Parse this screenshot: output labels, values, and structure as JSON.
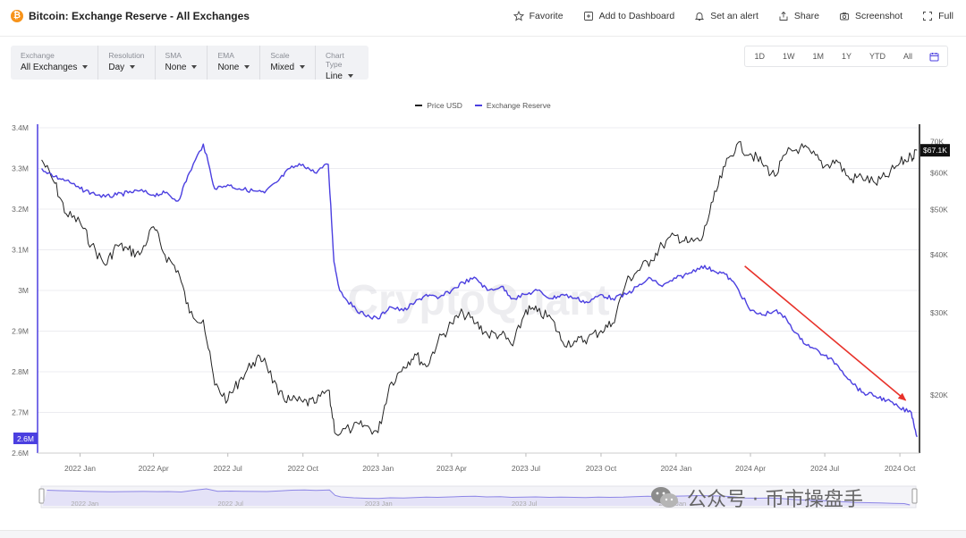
{
  "header": {
    "logo_symbol": "₿",
    "title": "Bitcoin: Exchange Reserve - All Exchanges",
    "actions": [
      {
        "label": "Favorite",
        "icon": "star-icon"
      },
      {
        "label": "Add to Dashboard",
        "icon": "dashboard-add-icon"
      },
      {
        "label": "Set an alert",
        "icon": "bell-icon"
      },
      {
        "label": "Share",
        "icon": "share-icon"
      },
      {
        "label": "Screenshot",
        "icon": "camera-icon"
      },
      {
        "label": "Full",
        "icon": "fullscreen-icon"
      }
    ]
  },
  "filters": [
    {
      "label": "Exchange",
      "value": "All Exchanges"
    },
    {
      "label": "Resolution",
      "value": "Day"
    },
    {
      "label": "SMA",
      "value": "None"
    },
    {
      "label": "EMA",
      "value": "None"
    },
    {
      "label": "Scale",
      "value": "Mixed"
    },
    {
      "label": "Chart Type",
      "value": "Line"
    }
  ],
  "ranges": [
    "1D",
    "1W",
    "1M",
    "1Y",
    "YTD",
    "All"
  ],
  "watermark": "CryptoQuant",
  "wechat_text": "公众号 · 币市操盘手",
  "colors": {
    "price": "#222222",
    "reserve": "#4b3fe0",
    "arrow": "#e8322a",
    "badge_reserve": "#4b3fe0",
    "badge_price": "#111111"
  },
  "chart_data": {
    "type": "line",
    "legend": [
      "Price USD",
      "Exchange Reserve"
    ],
    "legend_position": "top-center",
    "grid": {
      "horizontal": true,
      "vertical": false
    },
    "x_ticks": [
      "2022 Jan",
      "2022 Apr",
      "2022 Jul",
      "2022 Oct",
      "2023 Jan",
      "2023 Apr",
      "2023 Jul",
      "2023 Oct",
      "2024 Jan",
      "2024 Apr",
      "2024 Jul",
      "2024 Oct"
    ],
    "y_left": {
      "label": "",
      "ticks": [
        "3.4M",
        "3.3M",
        "3.2M",
        "3.1M",
        "3M",
        "2.9M",
        "2.8M",
        "2.7M",
        "2.6M"
      ],
      "range": [
        2.6,
        3.4
      ],
      "unit": "M BTC"
    },
    "y_right": {
      "label": "",
      "scale": "log",
      "ticks": [
        "70K",
        "$60K",
        "$50K",
        "$40K",
        "$30K",
        "$20K"
      ],
      "range_usd": [
        15000,
        75000
      ]
    },
    "current_values": {
      "reserve": "2.6M",
      "price": "$67.1K"
    },
    "series": [
      {
        "name": "Exchange Reserve",
        "axis": "left",
        "points": [
          [
            "2021-11-15",
            3.3
          ],
          [
            "2021-12-01",
            3.28
          ],
          [
            "2021-12-15",
            3.27
          ],
          [
            "2022-01-01",
            3.25
          ],
          [
            "2022-01-15",
            3.24
          ],
          [
            "2022-02-01",
            3.23
          ],
          [
            "2022-02-15",
            3.235
          ],
          [
            "2022-03-01",
            3.24
          ],
          [
            "2022-03-15",
            3.245
          ],
          [
            "2022-04-01",
            3.235
          ],
          [
            "2022-04-15",
            3.24
          ],
          [
            "2022-05-01",
            3.22
          ],
          [
            "2022-05-15",
            3.29
          ],
          [
            "2022-06-01",
            3.36
          ],
          [
            "2022-06-15",
            3.25
          ],
          [
            "2022-07-01",
            3.26
          ],
          [
            "2022-07-15",
            3.25
          ],
          [
            "2022-08-01",
            3.245
          ],
          [
            "2022-08-15",
            3.24
          ],
          [
            "2022-09-01",
            3.27
          ],
          [
            "2022-09-15",
            3.3
          ],
          [
            "2022-10-01",
            3.31
          ],
          [
            "2022-10-15",
            3.29
          ],
          [
            "2022-11-01",
            3.31
          ],
          [
            "2022-11-08",
            3.07
          ],
          [
            "2022-11-15",
            3.0
          ],
          [
            "2022-12-01",
            2.96
          ],
          [
            "2022-12-15",
            2.94
          ],
          [
            "2023-01-01",
            2.93
          ],
          [
            "2023-01-15",
            2.96
          ],
          [
            "2023-02-01",
            2.95
          ],
          [
            "2023-02-15",
            2.97
          ],
          [
            "2023-03-01",
            2.99
          ],
          [
            "2023-03-15",
            2.98
          ],
          [
            "2023-04-01",
            3.0
          ],
          [
            "2023-04-15",
            3.02
          ],
          [
            "2023-05-01",
            3.03
          ],
          [
            "2023-05-15",
            3.0
          ],
          [
            "2023-06-01",
            3.01
          ],
          [
            "2023-06-15",
            2.98
          ],
          [
            "2023-07-01",
            2.99
          ],
          [
            "2023-07-15",
            3.0
          ],
          [
            "2023-08-01",
            2.98
          ],
          [
            "2023-08-15",
            2.99
          ],
          [
            "2023-09-01",
            2.98
          ],
          [
            "2023-09-15",
            2.97
          ],
          [
            "2023-10-01",
            2.99
          ],
          [
            "2023-10-15",
            2.98
          ],
          [
            "2023-11-01",
            2.99
          ],
          [
            "2023-11-15",
            3.01
          ],
          [
            "2023-12-01",
            3.03
          ],
          [
            "2023-12-15",
            3.01
          ],
          [
            "2024-01-01",
            3.03
          ],
          [
            "2024-01-15",
            3.04
          ],
          [
            "2024-02-01",
            3.06
          ],
          [
            "2024-02-15",
            3.05
          ],
          [
            "2024-03-01",
            3.04
          ],
          [
            "2024-03-15",
            3.01
          ],
          [
            "2024-04-01",
            2.95
          ],
          [
            "2024-04-15",
            2.94
          ],
          [
            "2024-05-01",
            2.95
          ],
          [
            "2024-05-15",
            2.93
          ],
          [
            "2024-06-01",
            2.88
          ],
          [
            "2024-06-15",
            2.86
          ],
          [
            "2024-07-01",
            2.84
          ],
          [
            "2024-07-15",
            2.82
          ],
          [
            "2024-08-01",
            2.78
          ],
          [
            "2024-08-15",
            2.75
          ],
          [
            "2024-09-01",
            2.74
          ],
          [
            "2024-09-15",
            2.73
          ],
          [
            "2024-10-01",
            2.71
          ],
          [
            "2024-10-15",
            2.7
          ],
          [
            "2024-10-22",
            2.64
          ]
        ]
      },
      {
        "name": "Price USD",
        "axis": "right",
        "points": [
          [
            "2021-11-15",
            64000
          ],
          [
            "2021-12-01",
            57000
          ],
          [
            "2021-12-15",
            49000
          ],
          [
            "2022-01-01",
            47000
          ],
          [
            "2022-01-15",
            42000
          ],
          [
            "2022-02-01",
            38000
          ],
          [
            "2022-02-15",
            42000
          ],
          [
            "2022-03-01",
            41000
          ],
          [
            "2022-03-15",
            40000
          ],
          [
            "2022-04-01",
            46000
          ],
          [
            "2022-04-15",
            40000
          ],
          [
            "2022-05-01",
            37000
          ],
          [
            "2022-05-15",
            30000
          ],
          [
            "2022-06-01",
            29000
          ],
          [
            "2022-06-15",
            21000
          ],
          [
            "2022-07-01",
            19500
          ],
          [
            "2022-07-15",
            21500
          ],
          [
            "2022-08-01",
            23500
          ],
          [
            "2022-08-15",
            24000
          ],
          [
            "2022-09-01",
            20000
          ],
          [
            "2022-09-15",
            19500
          ],
          [
            "2022-10-01",
            19300
          ],
          [
            "2022-10-15",
            19200
          ],
          [
            "2022-11-01",
            20500
          ],
          [
            "2022-11-10",
            16500
          ],
          [
            "2022-12-01",
            17000
          ],
          [
            "2022-12-15",
            17200
          ],
          [
            "2023-01-01",
            16600
          ],
          [
            "2023-01-15",
            21000
          ],
          [
            "2023-02-01",
            23000
          ],
          [
            "2023-02-15",
            24500
          ],
          [
            "2023-03-01",
            23000
          ],
          [
            "2023-03-15",
            26000
          ],
          [
            "2023-04-01",
            28500
          ],
          [
            "2023-04-15",
            30000
          ],
          [
            "2023-05-01",
            28500
          ],
          [
            "2023-05-15",
            27000
          ],
          [
            "2023-06-01",
            27000
          ],
          [
            "2023-06-15",
            25500
          ],
          [
            "2023-07-01",
            30500
          ],
          [
            "2023-07-15",
            30200
          ],
          [
            "2023-08-01",
            29200
          ],
          [
            "2023-08-15",
            26000
          ],
          [
            "2023-09-01",
            26000
          ],
          [
            "2023-09-15",
            26500
          ],
          [
            "2023-10-01",
            27500
          ],
          [
            "2023-10-15",
            28500
          ],
          [
            "2023-11-01",
            35000
          ],
          [
            "2023-11-15",
            37000
          ],
          [
            "2023-12-01",
            39000
          ],
          [
            "2023-12-15",
            42000
          ],
          [
            "2024-01-01",
            44000
          ],
          [
            "2024-01-15",
            42500
          ],
          [
            "2024-02-01",
            43000
          ],
          [
            "2024-02-15",
            52000
          ],
          [
            "2024-03-01",
            62000
          ],
          [
            "2024-03-15",
            69000
          ],
          [
            "2024-04-01",
            66000
          ],
          [
            "2024-04-15",
            63000
          ],
          [
            "2024-05-01",
            59000
          ],
          [
            "2024-05-15",
            66000
          ],
          [
            "2024-06-01",
            68000
          ],
          [
            "2024-06-15",
            66000
          ],
          [
            "2024-07-01",
            62000
          ],
          [
            "2024-07-15",
            64000
          ],
          [
            "2024-08-01",
            58000
          ],
          [
            "2024-08-15",
            59000
          ],
          [
            "2024-09-01",
            57000
          ],
          [
            "2024-09-15",
            59000
          ],
          [
            "2024-10-01",
            63000
          ],
          [
            "2024-10-15",
            65000
          ],
          [
            "2024-10-22",
            67100
          ]
        ]
      }
    ],
    "annotations": [
      {
        "type": "arrow",
        "color": "#e8322a",
        "from": [
          "2024-03-25",
          3.06
        ],
        "to": [
          "2024-10-08",
          2.73
        ]
      }
    ],
    "navigator": {
      "labels": [
        "2022 Jan",
        "2022 Jul",
        "2023 Jan",
        "2023 Jul",
        "2024 Jan"
      ]
    }
  }
}
